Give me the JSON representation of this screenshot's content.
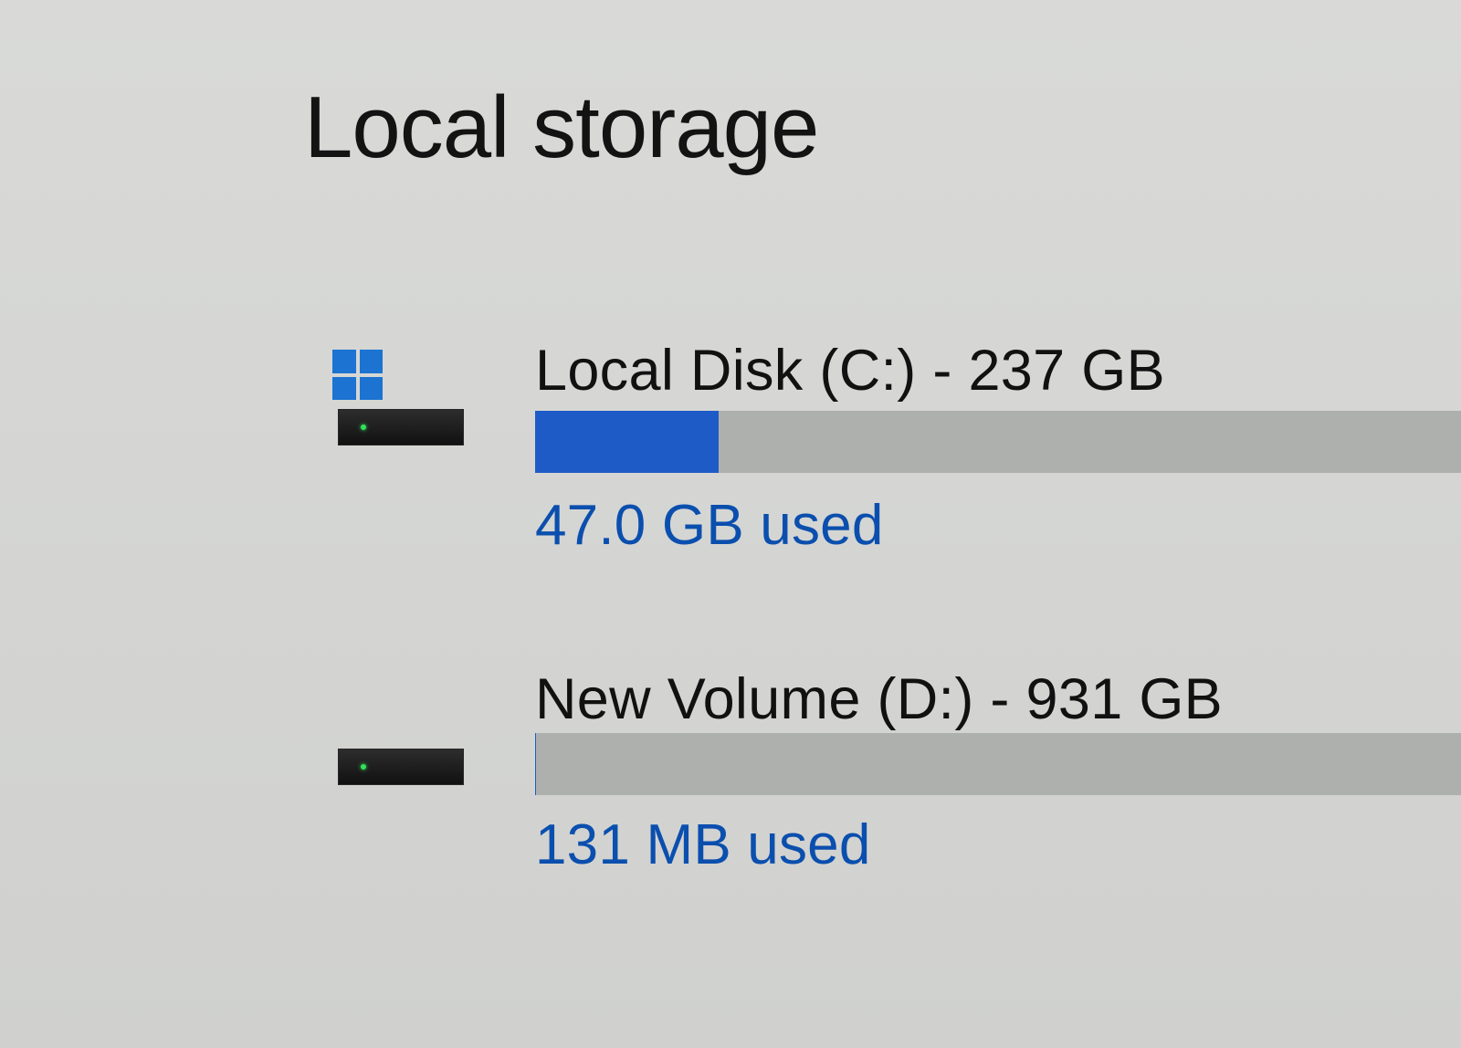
{
  "section": {
    "title": "Local storage"
  },
  "drives": [
    {
      "label": "Local Disk (C:) - 237 GB",
      "usage_text": "47.0 GB used",
      "used_fraction": 0.198,
      "icon": "drive-with-windows-logo"
    },
    {
      "label": "New Volume (D:) - 931 GB",
      "usage_text": "131 MB used",
      "used_fraction": 0.0001,
      "icon": "drive-icon"
    }
  ],
  "colors": {
    "accent": "#1f5bc6",
    "used_text": "#0b4fae",
    "bar_track": "#aeb0ae",
    "windows_logo": "#1c73d2"
  }
}
